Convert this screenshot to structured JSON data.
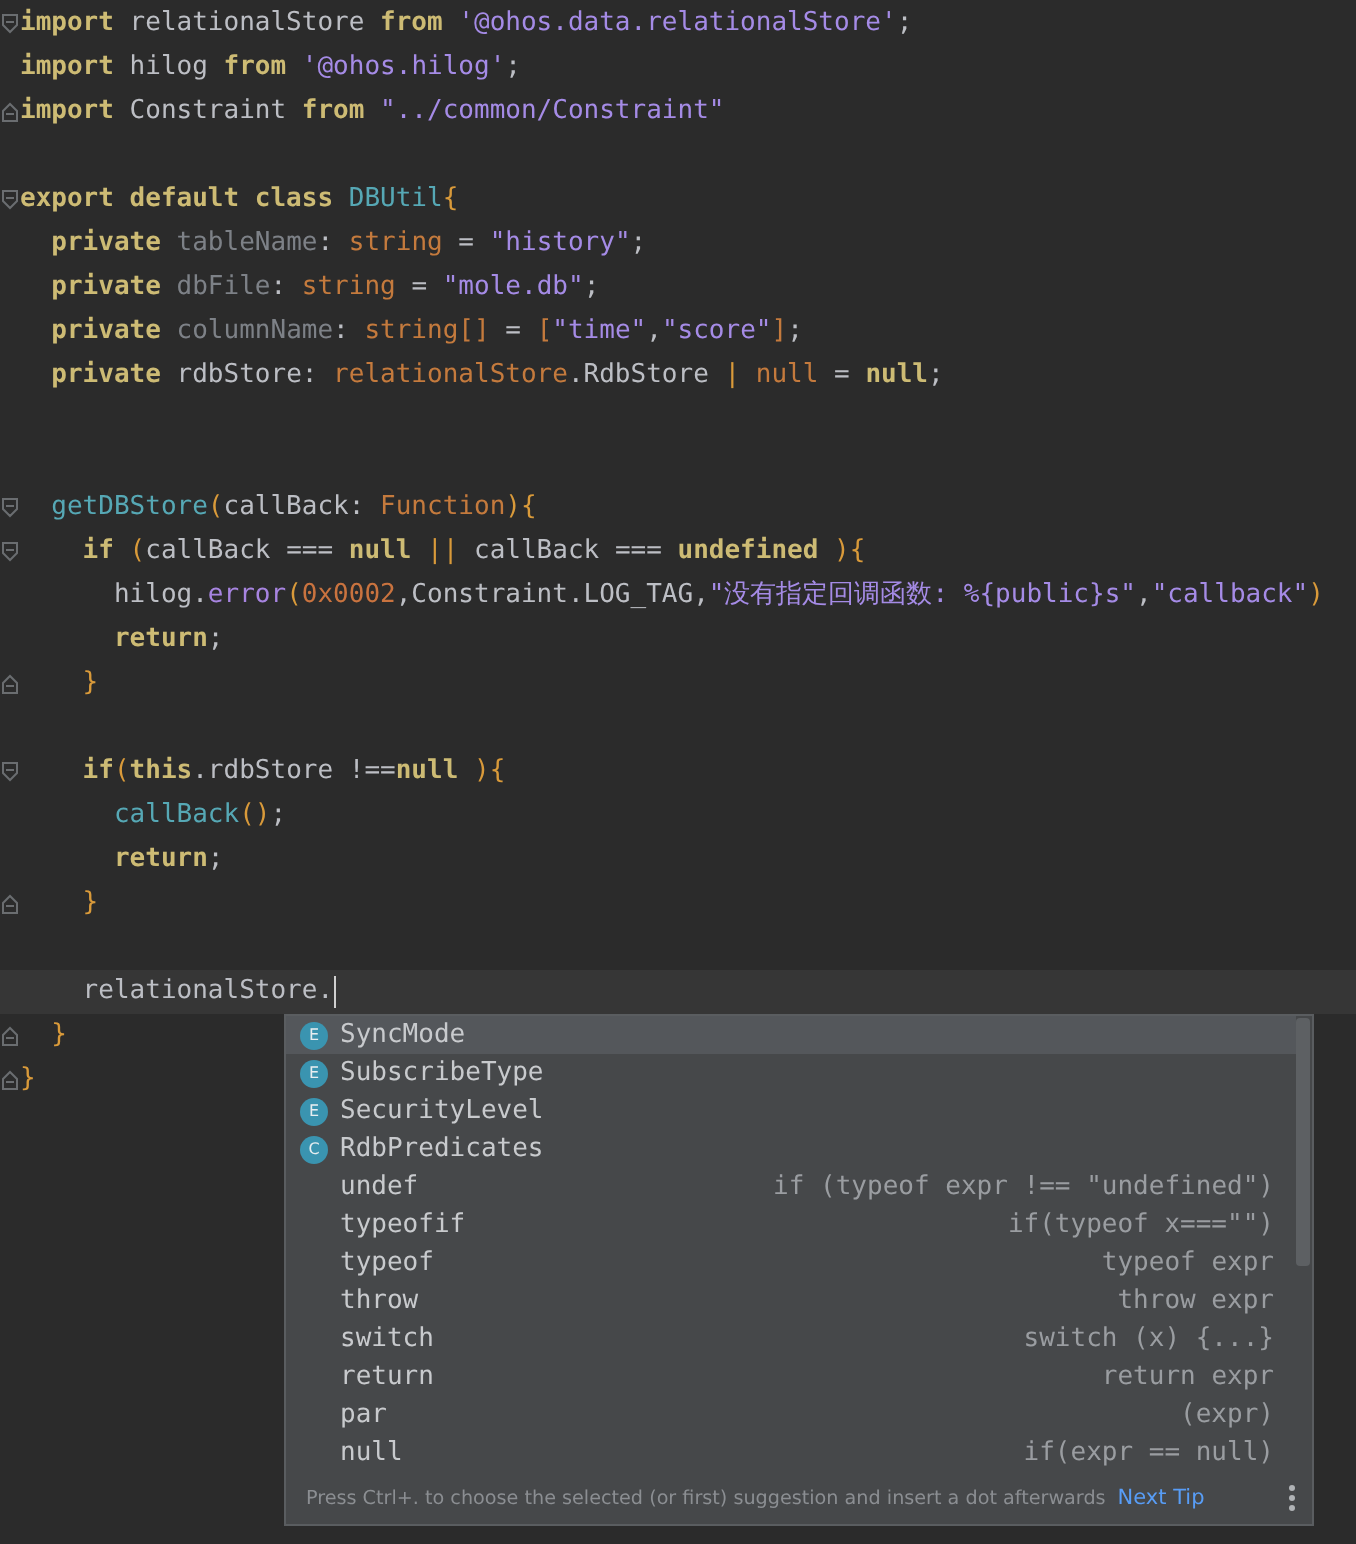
{
  "editor": {
    "lines": [
      {
        "fold_start": true,
        "fold_end": false,
        "current": false,
        "tokens": [
          {
            "kind": "kw",
            "t": "import"
          },
          {
            "kind": "plain",
            "t": " relationalStore "
          },
          {
            "kind": "kw",
            "t": "from"
          },
          {
            "kind": "str",
            "t": " '@ohos.data.relationalStore'"
          },
          {
            "kind": "plain",
            "t": ";"
          }
        ]
      },
      {
        "fold_start": false,
        "fold_end": false,
        "current": false,
        "tokens": [
          {
            "kind": "kw",
            "t": "import"
          },
          {
            "kind": "plain",
            "t": " hilog "
          },
          {
            "kind": "kw",
            "t": "from"
          },
          {
            "kind": "str",
            "t": " '@ohos.hilog'"
          },
          {
            "kind": "plain",
            "t": ";"
          }
        ]
      },
      {
        "fold_start": false,
        "fold_end": true,
        "current": false,
        "tokens": [
          {
            "kind": "kw",
            "t": "import"
          },
          {
            "kind": "plain",
            "t": " Constraint "
          },
          {
            "kind": "kw",
            "t": "from"
          },
          {
            "kind": "str",
            "t": " \"../common/Constraint\""
          }
        ]
      },
      {
        "fold_start": false,
        "fold_end": false,
        "current": false
      },
      {
        "fold_start": true,
        "fold_end": false,
        "current": false,
        "tokens": [
          {
            "kind": "kw",
            "t": "export default class"
          },
          {
            "kind": "fn",
            "t": " DBUtil"
          },
          {
            "kind": "brace",
            "t": "{"
          }
        ]
      },
      {
        "fold_start": false,
        "fold_end": false,
        "current": false,
        "tokens": [
          {
            "kind": "kw",
            "t": "  private"
          },
          {
            "kind": "field",
            "t": " tableName"
          },
          {
            "kind": "plain",
            "t": ": "
          },
          {
            "kind": "type",
            "t": "string"
          },
          {
            "kind": "plain",
            "t": " = "
          },
          {
            "kind": "str",
            "t": "\"history\""
          },
          {
            "kind": "plain",
            "t": ";"
          }
        ]
      },
      {
        "fold_start": false,
        "fold_end": false,
        "current": false,
        "tokens": [
          {
            "kind": "kw",
            "t": "  private"
          },
          {
            "kind": "field",
            "t": " dbFile"
          },
          {
            "kind": "plain",
            "t": ": "
          },
          {
            "kind": "type",
            "t": "string"
          },
          {
            "kind": "plain",
            "t": " = "
          },
          {
            "kind": "str",
            "t": "\"mole.db\""
          },
          {
            "kind": "plain",
            "t": ";"
          }
        ]
      },
      {
        "fold_start": false,
        "fold_end": false,
        "current": false,
        "tokens": [
          {
            "kind": "kw",
            "t": "  private"
          },
          {
            "kind": "field",
            "t": " columnName"
          },
          {
            "kind": "plain",
            "t": ": "
          },
          {
            "kind": "type",
            "t": "string[]"
          },
          {
            "kind": "plain",
            "t": " = "
          },
          {
            "kind": "type",
            "t": "["
          },
          {
            "kind": "str",
            "t": "\"time\""
          },
          {
            "kind": "plain",
            "t": ","
          },
          {
            "kind": "str",
            "t": "\"score\""
          },
          {
            "kind": "type",
            "t": "]"
          },
          {
            "kind": "plain",
            "t": ";"
          }
        ]
      },
      {
        "fold_start": false,
        "fold_end": false,
        "current": false,
        "tokens": [
          {
            "kind": "kw",
            "t": "  private"
          },
          {
            "kind": "plain",
            "t": " rdbStore: "
          },
          {
            "kind": "type",
            "t": "relationalStore"
          },
          {
            "kind": "plain",
            "t": ".RdbStore "
          },
          {
            "kind": "brace",
            "t": "|"
          },
          {
            "kind": "type",
            "t": " null"
          },
          {
            "kind": "plain",
            "t": " = "
          },
          {
            "kind": "kw",
            "t": "null"
          },
          {
            "kind": "plain",
            "t": ";"
          }
        ]
      },
      {
        "fold_start": false,
        "fold_end": false,
        "current": false
      },
      {
        "fold_start": false,
        "fold_end": false,
        "current": false
      },
      {
        "fold_start": true,
        "fold_end": false,
        "current": false,
        "tokens": [
          {
            "kind": "fn",
            "t": "  getDBStore"
          },
          {
            "kind": "brace",
            "t": "("
          },
          {
            "kind": "plain",
            "t": "callBack: "
          },
          {
            "kind": "type",
            "t": "Function"
          },
          {
            "kind": "brace",
            "t": "){"
          }
        ]
      },
      {
        "fold_start": true,
        "fold_end": false,
        "current": false,
        "tokens": [
          {
            "kind": "kw",
            "t": "    if"
          },
          {
            "kind": "brace",
            "t": " ("
          },
          {
            "kind": "plain",
            "t": "callBack === "
          },
          {
            "kind": "kw",
            "t": "null"
          },
          {
            "kind": "brace",
            "t": " ||"
          },
          {
            "kind": "plain",
            "t": " callBack === "
          },
          {
            "kind": "kw",
            "t": "undefined"
          },
          {
            "kind": "brace",
            "t": " ){"
          }
        ]
      },
      {
        "fold_start": false,
        "fold_end": false,
        "current": false,
        "tokens": [
          {
            "kind": "plain",
            "t": "      hilog."
          },
          {
            "kind": "method",
            "t": "error"
          },
          {
            "kind": "brace",
            "t": "("
          },
          {
            "kind": "num",
            "t": "0x0002"
          },
          {
            "kind": "plain",
            "t": ",Constraint.LOG_TAG,"
          },
          {
            "kind": "str",
            "t": "\"没有指定回调函数: %{public}s\""
          },
          {
            "kind": "plain",
            "t": ","
          },
          {
            "kind": "str",
            "t": "\"callback\""
          },
          {
            "kind": "brace",
            "t": ")"
          }
        ]
      },
      {
        "fold_start": false,
        "fold_end": false,
        "current": false,
        "tokens": [
          {
            "kind": "kw",
            "t": "      return"
          },
          {
            "kind": "plain",
            "t": ";"
          }
        ]
      },
      {
        "fold_start": false,
        "fold_end": true,
        "current": false,
        "tokens": [
          {
            "kind": "brace",
            "t": "    }"
          }
        ]
      },
      {
        "fold_start": false,
        "fold_end": false,
        "current": false
      },
      {
        "fold_start": true,
        "fold_end": false,
        "current": false,
        "tokens": [
          {
            "kind": "kw",
            "t": "    if"
          },
          {
            "kind": "brace",
            "t": "("
          },
          {
            "kind": "kw",
            "t": "this"
          },
          {
            "kind": "plain",
            "t": ".rdbStore !=="
          },
          {
            "kind": "kw",
            "t": "null"
          },
          {
            "kind": "brace",
            "t": " ){"
          }
        ]
      },
      {
        "fold_start": false,
        "fold_end": false,
        "current": false,
        "tokens": [
          {
            "kind": "fn",
            "t": "      callBack"
          },
          {
            "kind": "brace",
            "t": "()"
          },
          {
            "kind": "plain",
            "t": ";"
          }
        ]
      },
      {
        "fold_start": false,
        "fold_end": false,
        "current": false,
        "tokens": [
          {
            "kind": "kw",
            "t": "      return"
          },
          {
            "kind": "plain",
            "t": ";"
          }
        ]
      },
      {
        "fold_start": false,
        "fold_end": true,
        "current": false,
        "tokens": [
          {
            "kind": "brace",
            "t": "    }"
          }
        ]
      },
      {
        "fold_start": false,
        "fold_end": false,
        "current": false
      },
      {
        "fold_start": false,
        "fold_end": false,
        "current": true,
        "tokens": [
          {
            "kind": "plain",
            "t": "    relationalStore."
          }
        ]
      },
      {
        "fold_start": false,
        "fold_end": true,
        "current": false,
        "tokens": [
          {
            "kind": "brace",
            "t": "  }"
          }
        ]
      },
      {
        "fold_start": false,
        "fold_end": true,
        "current": false,
        "tokens": [
          {
            "kind": "brace",
            "t": "}"
          }
        ]
      }
    ]
  },
  "completion": {
    "items": [
      {
        "kind": "symbol",
        "icon": "E",
        "label": "SyncMode",
        "selected": true
      },
      {
        "kind": "symbol",
        "icon": "E",
        "label": "SubscribeType",
        "selected": false
      },
      {
        "kind": "symbol",
        "icon": "E",
        "label": "SecurityLevel",
        "selected": false
      },
      {
        "kind": "symbol",
        "icon": "C",
        "label": "RdbPredicates",
        "selected": false
      },
      {
        "kind": "template",
        "label": "undef",
        "hint": "if (typeof expr !== \"undefined\")",
        "selected": false
      },
      {
        "kind": "template",
        "label": "typeofif",
        "hint": "if(typeof x===\"\")",
        "selected": false
      },
      {
        "kind": "template",
        "label": "typeof",
        "hint": "typeof expr",
        "selected": false
      },
      {
        "kind": "template",
        "label": "throw",
        "hint": "throw expr",
        "selected": false
      },
      {
        "kind": "template",
        "label": "switch",
        "hint": "switch (x) {...}",
        "selected": false
      },
      {
        "kind": "template",
        "label": "return",
        "hint": "return expr",
        "selected": false
      },
      {
        "kind": "template",
        "label": "par",
        "hint": "(expr)",
        "selected": false
      },
      {
        "kind": "template",
        "label": "null",
        "hint": "if(expr == null)",
        "selected": false
      }
    ],
    "footer": {
      "tip": "Press Ctrl+. to choose the selected (or first) suggestion and insert a dot afterwards",
      "link": "Next Tip"
    }
  }
}
